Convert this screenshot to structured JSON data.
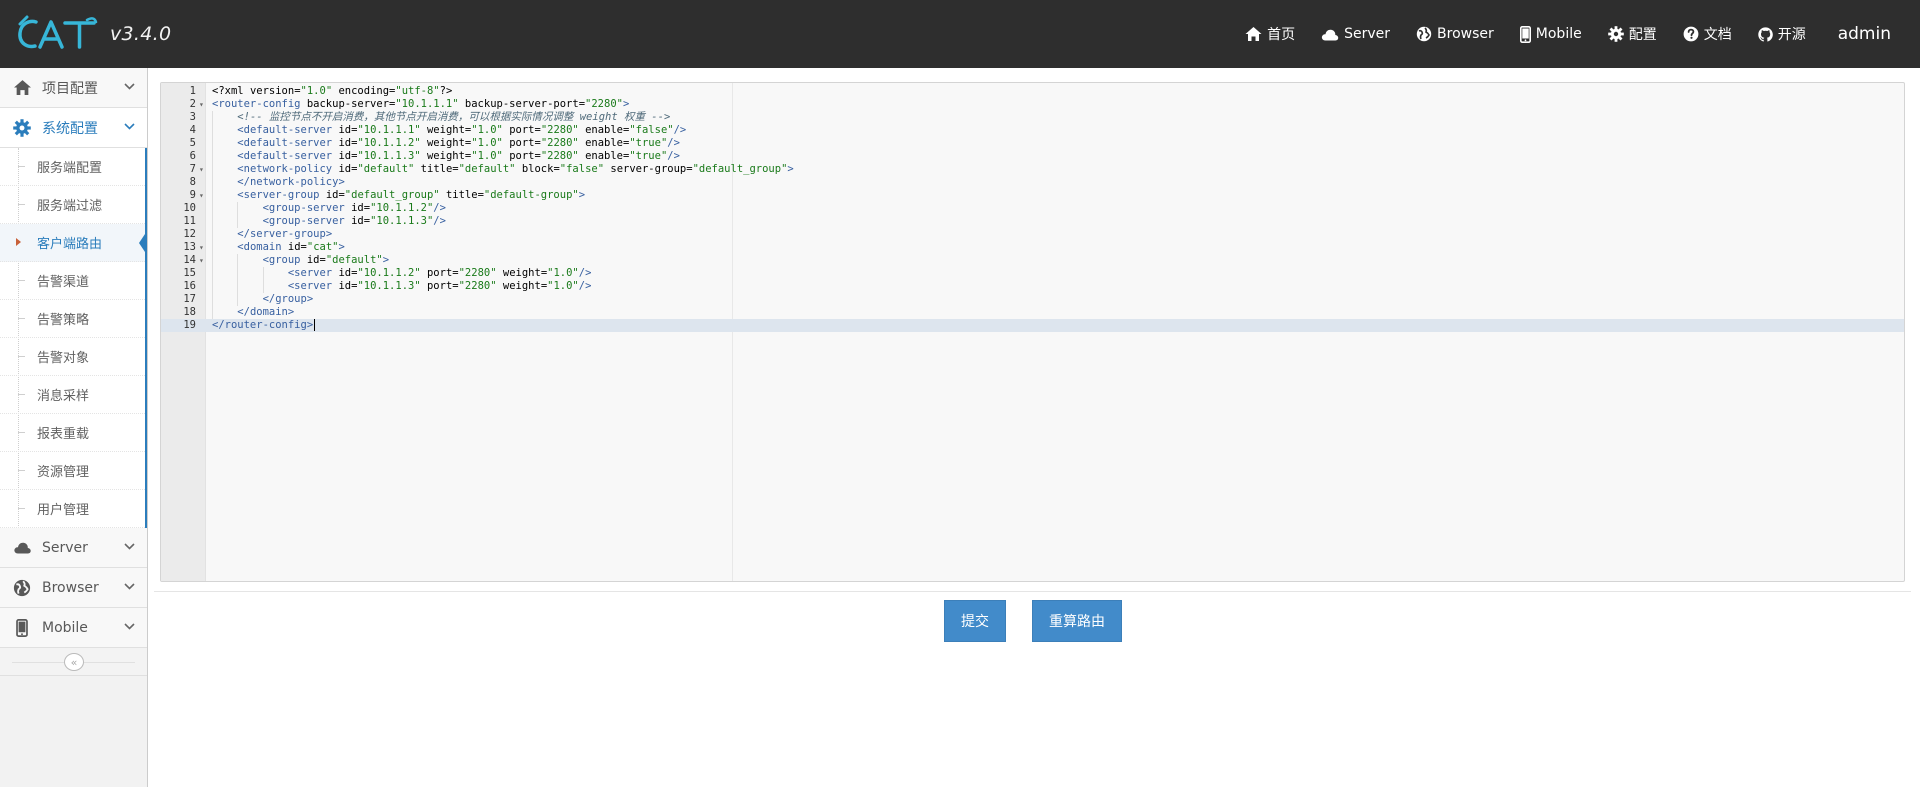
{
  "app": {
    "logo_text": "CAT",
    "version": "v3.4.0",
    "accent_color": "#2b7dbc",
    "logo_color": "#37b6d8"
  },
  "nav": {
    "items": [
      {
        "icon": "home-icon",
        "label": "首页"
      },
      {
        "icon": "cloud-icon",
        "label": "Server"
      },
      {
        "icon": "globe-icon",
        "label": "Browser"
      },
      {
        "icon": "mobile-icon",
        "label": "Mobile"
      },
      {
        "icon": "gear-icon",
        "label": "配置"
      },
      {
        "icon": "question-icon",
        "label": "文档"
      },
      {
        "icon": "github-icon",
        "label": "开源"
      }
    ],
    "user": "admin"
  },
  "sidebar": {
    "project_config": {
      "icon": "home-icon",
      "label": "项目配置"
    },
    "system_config": {
      "icon": "gear-icon",
      "label": "系统配置",
      "items": [
        {
          "label": "服务端配置"
        },
        {
          "label": "服务端过滤"
        },
        {
          "label": "客户端路由",
          "active": true
        },
        {
          "label": "告警渠道"
        },
        {
          "label": "告警策略"
        },
        {
          "label": "告警对象"
        },
        {
          "label": "消息采样"
        },
        {
          "label": "报表重载"
        },
        {
          "label": "资源管理"
        },
        {
          "label": "用户管理"
        }
      ]
    },
    "server": {
      "icon": "cloud-icon",
      "label": "Server"
    },
    "browser": {
      "icon": "globe-icon",
      "label": "Browser"
    },
    "mobile": {
      "icon": "mobile-icon",
      "label": "Mobile"
    },
    "collapse_glyph": "«"
  },
  "editor": {
    "line_numbers": [
      "1",
      "2",
      "3",
      "4",
      "5",
      "6",
      "7",
      "8",
      "9",
      "10",
      "11",
      "12",
      "13",
      "14",
      "15",
      "16",
      "17",
      "18",
      "19"
    ],
    "fold_lines": [
      2,
      7,
      9,
      13,
      14
    ],
    "active_line": 19,
    "lines": [
      "<?xml version=\"1.0\" encoding=\"utf-8\"?>",
      "<router-config backup-server=\"10.1.1.1\" backup-server-port=\"2280\">",
      "    <!-- 监控节点不开启消费，其他节点开启消费，可以根据实际情况调整 weight 权重 -->",
      "    <default-server id=\"10.1.1.1\" weight=\"1.0\" port=\"2280\" enable=\"false\"/>",
      "    <default-server id=\"10.1.1.2\" weight=\"1.0\" port=\"2280\" enable=\"true\"/>",
      "    <default-server id=\"10.1.1.3\" weight=\"1.0\" port=\"2280\" enable=\"true\"/>",
      "    <network-policy id=\"default\" title=\"default\" block=\"false\" server-group=\"default_group\">",
      "    </network-policy>",
      "    <server-group id=\"default_group\" title=\"default-group\">",
      "        <group-server id=\"10.1.1.2\"/>",
      "        <group-server id=\"10.1.1.3\"/>",
      "    </server-group>",
      "    <domain id=\"cat\">",
      "        <group id=\"default\">",
      "            <server id=\"10.1.1.2\" port=\"2280\" weight=\"1.0\"/>",
      "            <server id=\"10.1.1.3\" port=\"2280\" weight=\"1.0\"/>",
      "        </group>",
      "    </domain>",
      "</router-config>"
    ]
  },
  "actions": {
    "submit_label": "提交",
    "recalc_label": "重算路由",
    "button_color": "#428bca"
  }
}
